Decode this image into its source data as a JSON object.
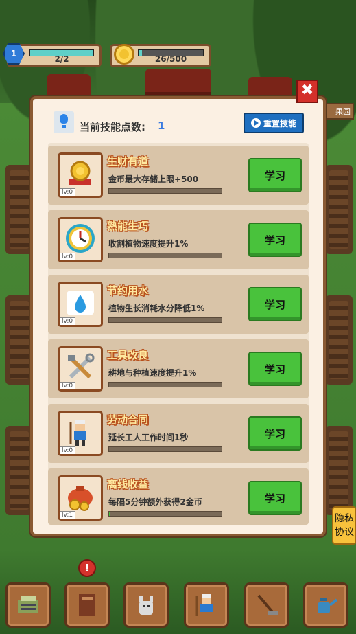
{
  "hud": {
    "level": "1",
    "exp_text": "2/2",
    "exp_progress": 1.0,
    "coins_text": "26/500",
    "coins_progress": 0.05
  },
  "panel": {
    "points_label": "当前技能点数:",
    "points_value": "1",
    "reset_label": "重置技能",
    "close_icon": "close-icon"
  },
  "skills": [
    {
      "name": "生财有道",
      "desc": "金币最大存储上限+500",
      "level": "lv:0",
      "progress": 0,
      "button": "学习",
      "icon": "coin-stack-icon"
    },
    {
      "name": "熟能生巧",
      "desc": "收割植物速度提升1%",
      "level": "lv:0",
      "progress": 0,
      "button": "学习",
      "icon": "clock-icon"
    },
    {
      "name": "节约用水",
      "desc": "植物生长消耗水分降低1%",
      "level": "lv:0",
      "progress": 0,
      "button": "学习",
      "icon": "water-drop-icon"
    },
    {
      "name": "工具改良",
      "desc": "耕地与种植速度提升1%",
      "level": "lv:0",
      "progress": 0,
      "button": "学习",
      "icon": "tools-icon"
    },
    {
      "name": "劳动合同",
      "desc": "延长工人工作时间1秒",
      "level": "lv:0",
      "progress": 0,
      "button": "学习",
      "icon": "worker-icon"
    },
    {
      "name": "离线收益",
      "desc": "每隔5分钟额外获得2金币",
      "level": "lv:1",
      "progress": 0.01,
      "button": "学习",
      "icon": "money-bag-icon"
    }
  ],
  "side": {
    "farm_sign": "果园",
    "privacy": "隐私协议"
  },
  "nav": [
    {
      "icon": "cash-register-icon"
    },
    {
      "icon": "book-icon",
      "alert": "!"
    },
    {
      "icon": "pet-icon"
    },
    {
      "icon": "farmer-icon"
    },
    {
      "icon": "hoe-icon"
    },
    {
      "icon": "watering-can-icon"
    }
  ],
  "colors": {
    "learn_button": "#49c23c",
    "reset_button": "#1f6fc0",
    "close_button": "#d4302a",
    "skill_name_outline": "#b8501c"
  }
}
